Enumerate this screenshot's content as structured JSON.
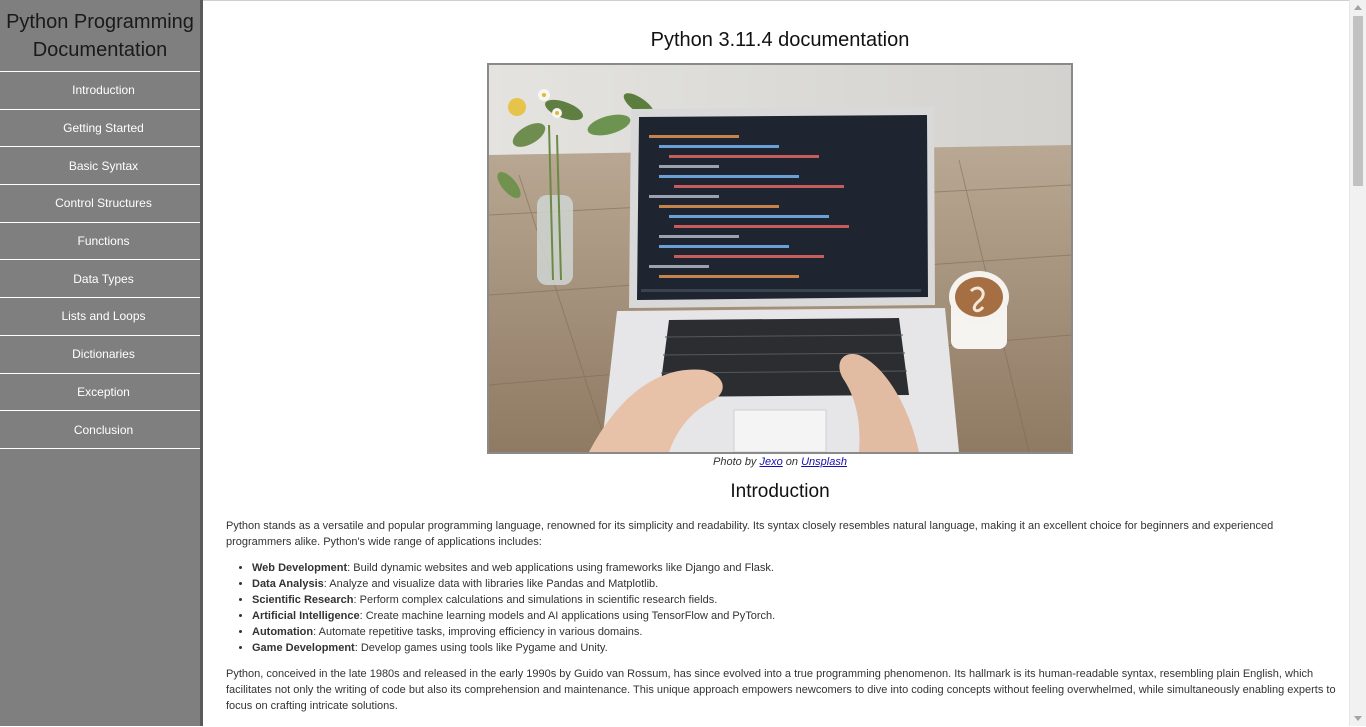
{
  "sidebar": {
    "title": "Python Programming Documentation",
    "items": [
      {
        "label": "Introduction"
      },
      {
        "label": "Getting Started"
      },
      {
        "label": "Basic Syntax"
      },
      {
        "label": "Control Structures"
      },
      {
        "label": "Functions"
      },
      {
        "label": "Data Types"
      },
      {
        "label": "Lists and Loops"
      },
      {
        "label": "Dictionaries"
      },
      {
        "label": "Exception"
      },
      {
        "label": "Conclusion"
      }
    ]
  },
  "main": {
    "title": "Python 3.11.4 documentation",
    "hero_image": "laptop-on-wooden-table-with-code-photo",
    "credit": {
      "prefix": "Photo by ",
      "author": "Jexo",
      "middle": " on ",
      "site": "Unsplash"
    },
    "intro": {
      "heading": "Introduction",
      "paragraph1": "Python stands as a versatile and popular programming language, renowned for its simplicity and readability. Its syntax closely resembles natural language, making it an excellent choice for beginners and experienced programmers alike. Python's wide range of applications includes:",
      "applications": [
        {
          "name": "Web Development",
          "desc": ": Build dynamic websites and web applications using frameworks like Django and Flask."
        },
        {
          "name": "Data Analysis",
          "desc": ": Analyze and visualize data with libraries like Pandas and Matplotlib."
        },
        {
          "name": "Scientific Research",
          "desc": ": Perform complex calculations and simulations in scientific research fields."
        },
        {
          "name": "Artificial Intelligence",
          "desc": ": Create machine learning models and AI applications using TensorFlow and PyTorch."
        },
        {
          "name": "Automation",
          "desc": ": Automate repetitive tasks, improving efficiency in various domains."
        },
        {
          "name": "Game Development",
          "desc": ": Develop games using tools like Pygame and Unity."
        }
      ],
      "paragraph2": "Python, conceived in the late 1980s and released in the early 1990s by Guido van Rossum, has since evolved into a true programming phenomenon. Its hallmark is its human-readable syntax, resembling plain English, which facilitates not only the writing of code but also its comprehension and maintenance. This unique approach empowers newcomers to dive into coding concepts without feeling overwhelmed, while simultaneously enabling experts to focus on crafting intricate solutions."
    }
  },
  "colors": {
    "sidebar_bg": "#7f7f7f",
    "link": "#1a0dab"
  }
}
